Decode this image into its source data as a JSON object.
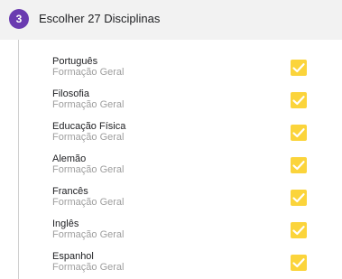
{
  "step": {
    "number": "3",
    "title": "Escolher 27 Disciplinas",
    "badge_color": "#6a3bb0"
  },
  "checkbox_color": "#fbd43b",
  "items": [
    {
      "title": "Português",
      "subtitle": "Formação Geral",
      "checked": true
    },
    {
      "title": "Filosofia",
      "subtitle": "Formação Geral",
      "checked": true
    },
    {
      "title": "Educação Física",
      "subtitle": "Formação Geral",
      "checked": true
    },
    {
      "title": "Alemão",
      "subtitle": "Formação Geral",
      "checked": true
    },
    {
      "title": "Francês",
      "subtitle": "Formação Geral",
      "checked": true
    },
    {
      "title": "Inglês",
      "subtitle": "Formação Geral",
      "checked": true
    },
    {
      "title": "Espanhol",
      "subtitle": "Formação Geral",
      "checked": true
    }
  ]
}
